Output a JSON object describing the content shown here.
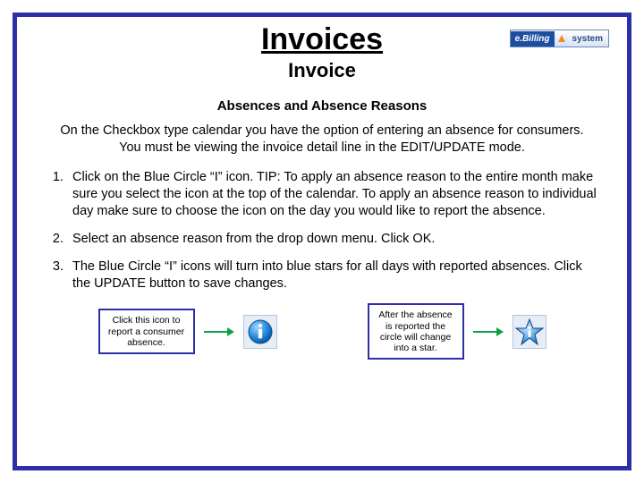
{
  "logo": {
    "left": "e.Billing",
    "right": "system"
  },
  "title": "Invoices",
  "subtitle": "Invoice",
  "section_title": "Absences and Absence Reasons",
  "intro": "On the Checkbox type calendar you have the option of entering an absence for consumers. You must be viewing the invoice detail line in the EDIT/UPDATE mode.",
  "steps": [
    "Click on the Blue Circle “I” icon. TIP: To apply an absence reason to the entire month make sure you select the icon at the top of the calendar. To apply an absence reason to individual day make sure to choose the icon on the day you would like to report the absence.",
    "Select an absence reason from the drop down menu. Click OK.",
    "The Blue Circle “I” icons will turn into blue stars for all days with reported absences. Click the UPDATE button to save changes."
  ],
  "callouts": {
    "left": "Click this icon to report a consumer absence.",
    "right": "After the absence is reported the circle will change into a star."
  }
}
